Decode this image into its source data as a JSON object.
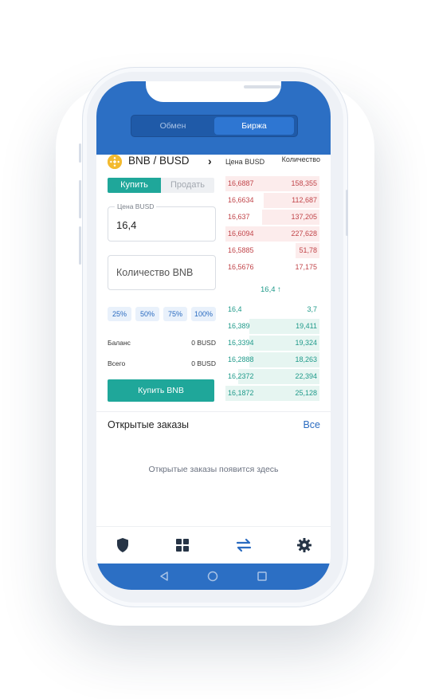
{
  "header": {
    "tabs": [
      {
        "label": "Обмен",
        "active": false
      },
      {
        "label": "Биржа",
        "active": true
      }
    ]
  },
  "pair": {
    "label": "BNB / BUSD",
    "coin_icon": "binance-coin-icon",
    "arrow_icon": "chevron-right-icon"
  },
  "trade": {
    "buy_tab": "Купить",
    "sell_tab": "Продать",
    "price_label": "Цена BUSD",
    "price_value": "16,4",
    "amount_placeholder": "Количество BNB",
    "percents": [
      "25%",
      "50%",
      "75%",
      "100%"
    ],
    "balance_label": "Баланс",
    "balance_value": "0 BUSD",
    "total_label": "Всего",
    "total_value": "0 BUSD",
    "buy_button": "Купить BNB"
  },
  "orderbook": {
    "price_header": "Цена BUSD",
    "qty_header": "Количество",
    "asks": [
      {
        "price": "16,6887",
        "qty": "158,355"
      },
      {
        "price": "16,6634",
        "qty": "112,687"
      },
      {
        "price": "16,637",
        "qty": "137,205"
      },
      {
        "price": "16,6094",
        "qty": "227,628"
      },
      {
        "price": "16,5885",
        "qty": "51,78"
      },
      {
        "price": "16,5676",
        "qty": "17,175"
      }
    ],
    "mid_price": "16,4 ↑",
    "bids": [
      {
        "price": "16,4",
        "qty": "3,7"
      },
      {
        "price": "16,389",
        "qty": "19,411"
      },
      {
        "price": "16,3394",
        "qty": "19,324"
      },
      {
        "price": "16,2888",
        "qty": "18,263"
      },
      {
        "price": "16,2372",
        "qty": "22,394"
      },
      {
        "price": "16,1872",
        "qty": "25,128"
      }
    ]
  },
  "orders": {
    "title": "Открытые заказы",
    "all_link": "Все",
    "empty_text": "Открытые заказы появится здесь"
  },
  "tabbar": {
    "icons": [
      "shield-icon",
      "grid-icon",
      "exchange-arrows-icon",
      "gear-icon"
    ],
    "active_index": 2
  },
  "navbar": {
    "icons": [
      "back-triangle-icon",
      "home-circle-icon",
      "recents-square-icon"
    ]
  },
  "colors": {
    "brand_blue": "#2c6fc4",
    "buy_green": "#1fa79a",
    "ask_red": "#c1454a",
    "coin_yellow": "#f3ba2f"
  }
}
